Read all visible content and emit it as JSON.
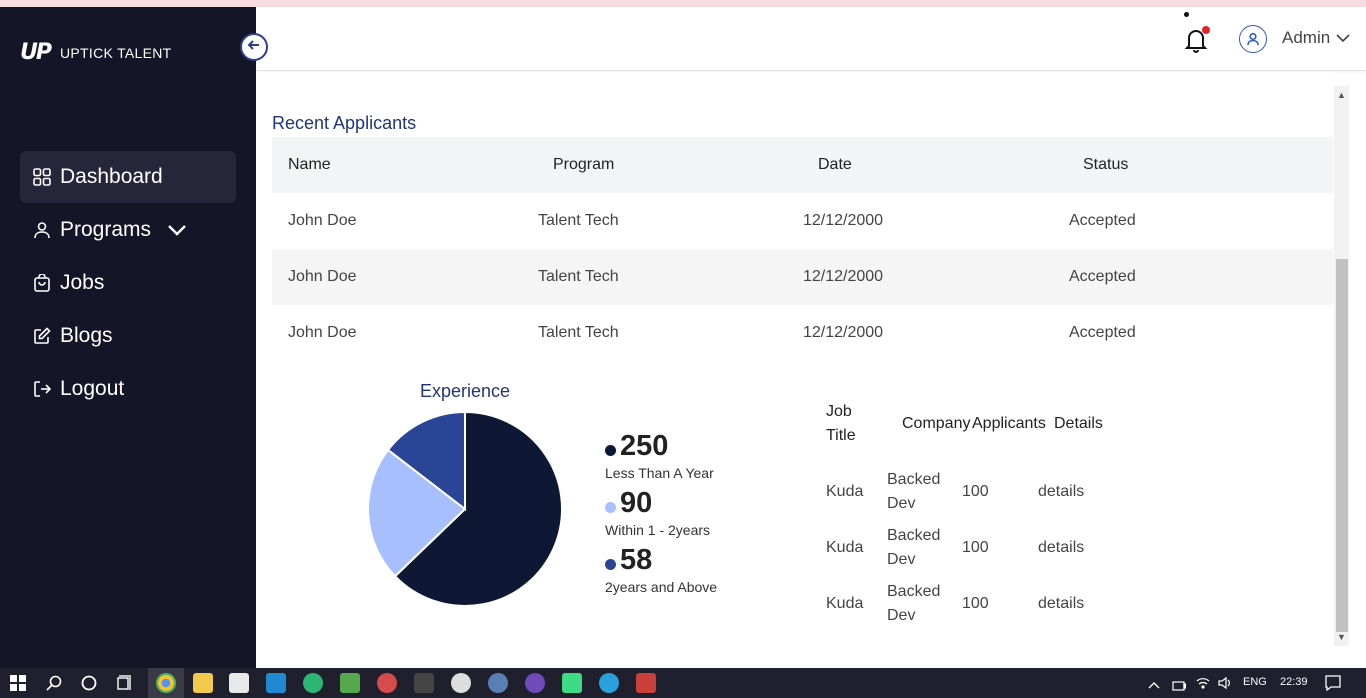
{
  "brand": {
    "mark": "UP",
    "name": "UPTICK TALENT"
  },
  "sidebar": {
    "items": [
      {
        "label": "Dashboard",
        "icon": "grid-icon",
        "active": true
      },
      {
        "label": "Programs",
        "icon": "user-icon",
        "has_chevron": true
      },
      {
        "label": "Jobs",
        "icon": "bag-icon"
      },
      {
        "label": "Blogs",
        "icon": "edit-icon"
      },
      {
        "label": "Logout",
        "icon": "logout-icon"
      }
    ]
  },
  "header": {
    "user_label": "Admin",
    "notification_icon": "bell-icon",
    "notification_badge_color": "#e0242c"
  },
  "recent_applicants": {
    "title": "Recent Applicants",
    "columns": [
      "Name",
      "Program",
      "Date",
      "Status"
    ],
    "rows": [
      [
        "John Doe",
        "Talent Tech",
        "12/12/2000",
        "Accepted"
      ],
      [
        "John Doe",
        "Talent Tech",
        "12/12/2000",
        "Accepted"
      ],
      [
        "John Doe",
        "Talent Tech",
        "12/12/2000",
        "Accepted"
      ]
    ]
  },
  "experience": {
    "title": "Experience",
    "legend": [
      {
        "value": "250",
        "label": "Less Than A Year",
        "color": "#0e1834"
      },
      {
        "value": "90",
        "label": "Within 1 - 2years",
        "color": "#a7bffd"
      },
      {
        "value": "58",
        "label": "2years and Above",
        "color": "#2a4596"
      }
    ]
  },
  "jobs_table": {
    "columns": [
      "Job Title",
      "Company",
      "Applicants",
      "Details"
    ],
    "rows": [
      [
        "Kuda",
        "Backed Dev",
        "100",
        "details"
      ],
      [
        "Kuda",
        "Backed Dev",
        "100",
        "details"
      ],
      [
        "Kuda",
        "Backed Dev",
        "100",
        "details"
      ]
    ]
  },
  "taskbar": {
    "language": "ENG",
    "time": "22:39"
  },
  "colors": {
    "sidebar_bg": "#141526",
    "accent": "#23357a",
    "active_nav": "#25263a"
  }
}
